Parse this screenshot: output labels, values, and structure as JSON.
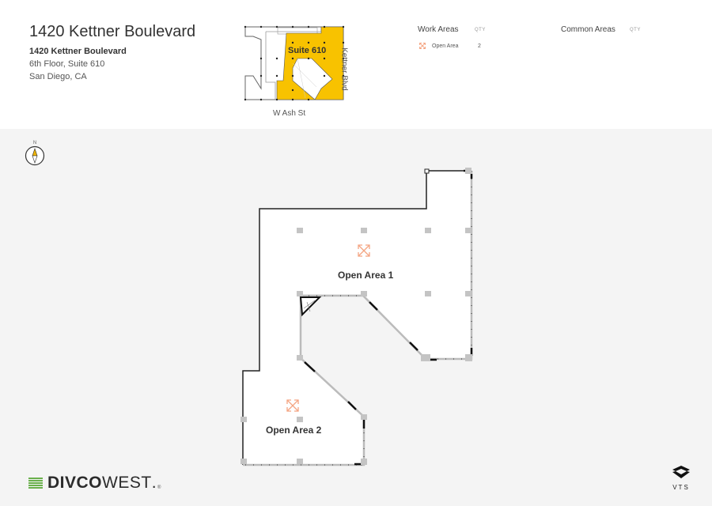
{
  "header": {
    "title": "1420 Kettner Boulevard",
    "address_line1": "1420 Kettner Boulevard",
    "address_line2": "6th Floor, Suite 610",
    "address_line3": "San Diego, CA"
  },
  "keyplan": {
    "suite_label": "Suite 610",
    "street_bottom": "W Ash St",
    "street_right": "Kettner Blvd",
    "highlight_color": "#f8c200"
  },
  "legend": {
    "work_areas": {
      "heading": "Work Areas",
      "qty_label": "QTY",
      "items": [
        {
          "icon": "expand-arrows-icon",
          "label": "Open Area",
          "qty": "2"
        }
      ]
    },
    "common_areas": {
      "heading": "Common Areas",
      "qty_label": "QTY",
      "items": []
    },
    "icon_color": "#f4a582"
  },
  "compass": {
    "label": "N"
  },
  "floorplan": {
    "areas": [
      {
        "name": "Open Area 1",
        "icon": "expand-arrows-icon"
      },
      {
        "name": "Open Area 2",
        "icon": "expand-arrows-icon"
      }
    ]
  },
  "footer": {
    "brand_bold": "DIVCO",
    "brand_light": "WEST",
    "brand_mark": ".",
    "brand_reg": "®",
    "brand_accent": "#6ab04c",
    "platform": "VTS"
  }
}
